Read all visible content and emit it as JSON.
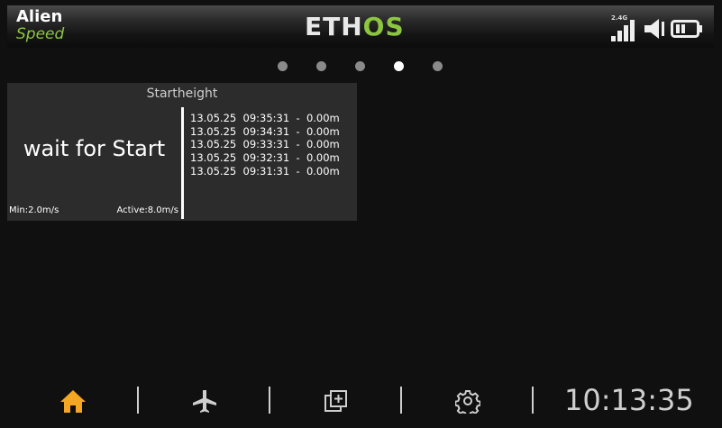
{
  "header": {
    "model_name": "Alien",
    "model_sub": "Speed",
    "logo_left": "ETH",
    "logo_right": "OS",
    "radio_band": "2.4G",
    "signal_icon": "signal-bars-icon",
    "audio_icon": "speaker-icon",
    "battery_icon": "battery-icon"
  },
  "pager": {
    "count": 5,
    "active_index": 3
  },
  "widget": {
    "title": "Startheight",
    "state": "wait for Start",
    "min_label": "Min:2.0m/s",
    "active_label": "Active:8.0m/s",
    "log": [
      "13.05.25  09:35:31  -  0.00m",
      "13.05.25  09:34:31  -  0.00m",
      "13.05.25  09:33:31  -  0.00m",
      "13.05.25  09:32:31  -  0.00m",
      "13.05.25  09:31:31  -  0.00m"
    ]
  },
  "nav": {
    "items": [
      {
        "icon": "home-icon",
        "active": true
      },
      {
        "icon": "airplane-icon",
        "active": false
      },
      {
        "icon": "system-icon",
        "active": false
      },
      {
        "icon": "gear-icon",
        "active": false
      }
    ],
    "time": "10:13:35"
  },
  "colors": {
    "accent_green": "#8cc63f",
    "active_orange": "#f5a623",
    "inactive": "#cfcfcf"
  }
}
